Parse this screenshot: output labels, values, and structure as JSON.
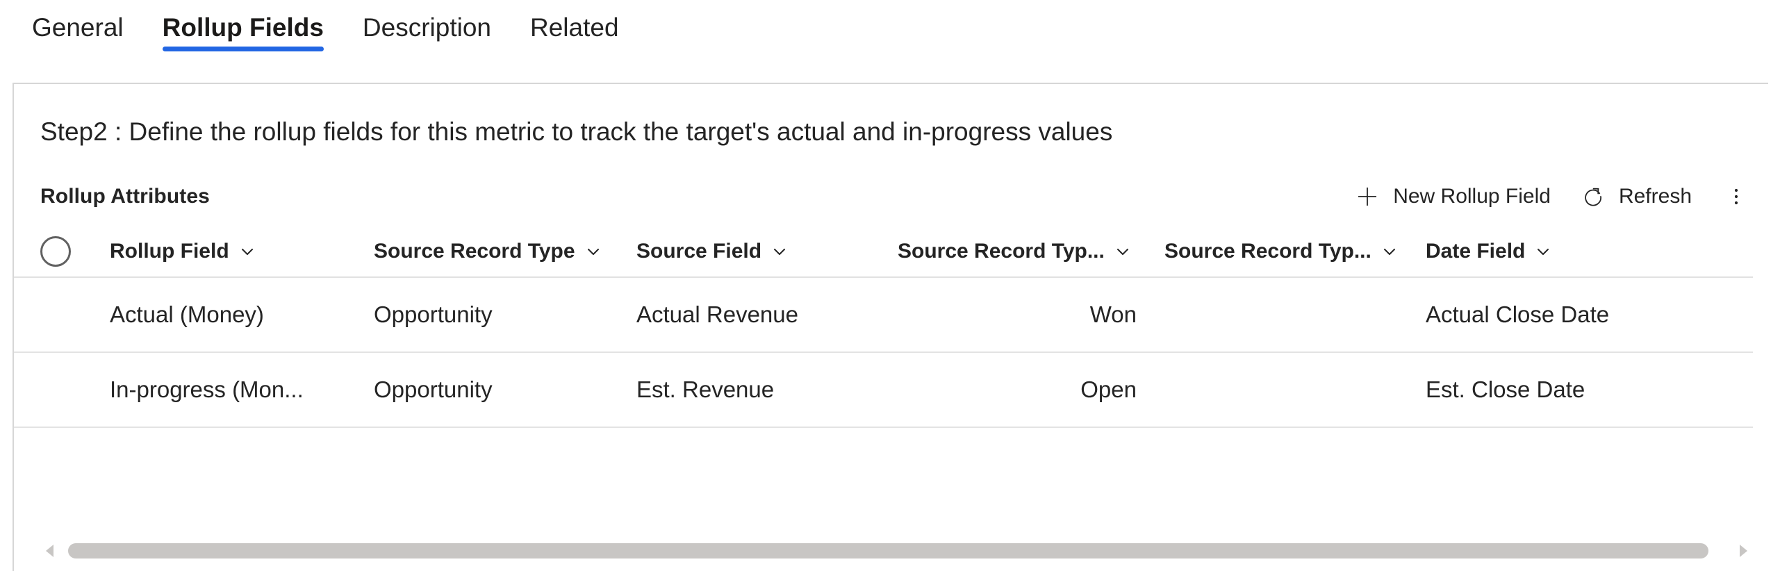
{
  "tabs": [
    {
      "label": "General",
      "active": false
    },
    {
      "label": "Rollup Fields",
      "active": true
    },
    {
      "label": "Description",
      "active": false
    },
    {
      "label": "Related",
      "active": false
    }
  ],
  "panel": {
    "step_text": "Step2 : Define the rollup fields for this metric to track the target's actual and in-progress values"
  },
  "commandbar": {
    "grid_title": "Rollup Attributes",
    "new_rollup_field_label": "New Rollup Field",
    "new_rollup_field_icon": "plus-icon",
    "refresh_label": "Refresh",
    "refresh_icon": "refresh-icon",
    "overflow_icon": "more-vertical-icon"
  },
  "grid": {
    "select_all_icon": "select-all-circle-icon",
    "columns": [
      {
        "label": "Rollup Field",
        "sort_icon": "chevron-down-icon",
        "align": "left"
      },
      {
        "label": "Source Record Type",
        "sort_icon": "chevron-down-icon",
        "align": "left"
      },
      {
        "label": "Source Field",
        "sort_icon": "chevron-down-icon",
        "align": "left"
      },
      {
        "label": "Source Record Typ...",
        "sort_icon": "chevron-down-icon",
        "align": "right"
      },
      {
        "label": "Source Record Typ...",
        "sort_icon": "chevron-down-icon",
        "align": "right"
      },
      {
        "label": "Date Field",
        "sort_icon": "chevron-down-icon",
        "align": "left"
      }
    ],
    "rows": [
      {
        "rollup_field": "Actual (Money)",
        "source_record_type": "Opportunity",
        "source_field": "Actual Revenue",
        "source_record_type_2": "Won",
        "source_record_type_3": "",
        "date_field": "Actual Close Date"
      },
      {
        "rollup_field": "In-progress (Mon...",
        "source_record_type": "Opportunity",
        "source_field": "Est. Revenue",
        "source_record_type_2": "Open",
        "source_record_type_3": "",
        "date_field": "Est. Close Date"
      }
    ]
  },
  "scrollbar": {
    "left_arrow_icon": "caret-left-icon",
    "right_arrow_icon": "caret-right-icon",
    "thumb_percent": 99
  },
  "colors": {
    "accent": "#2266e3",
    "text": "#242424",
    "divider": "#e1e1e1",
    "panel_border": "#d6d6d6",
    "scrollbar_thumb": "#c8c6c4"
  }
}
